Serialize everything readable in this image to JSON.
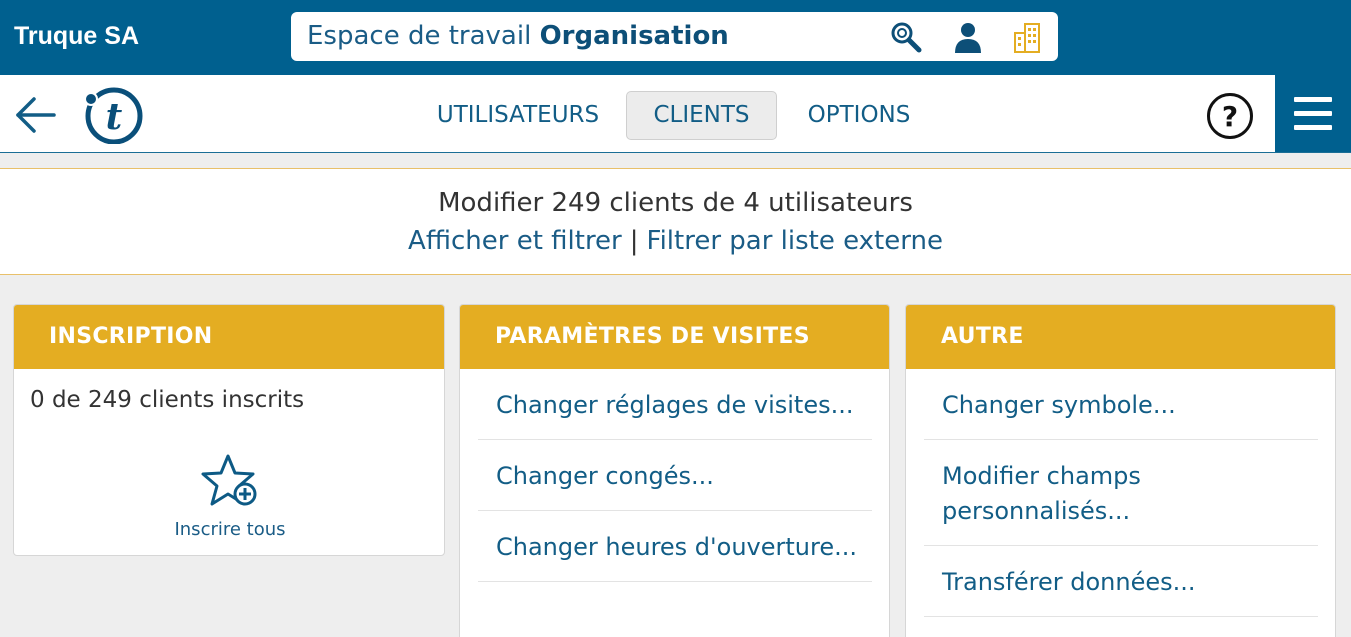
{
  "topbar": {
    "company": "Truque SA",
    "workspace_prefix": "Espace de travail ",
    "workspace_name": "Organisation",
    "icons": [
      "search-icon",
      "user-icon",
      "building-icon"
    ]
  },
  "nav": {
    "tabs": [
      {
        "label": "UTILISATEURS",
        "active": false
      },
      {
        "label": "CLIENTS",
        "active": true
      },
      {
        "label": "OPTIONS",
        "active": false
      }
    ],
    "help": "?"
  },
  "summary": {
    "title": "Modifier 249 clients de 4 utilisateurs",
    "link_show": "Afficher et filtrer",
    "separator": "|",
    "link_external": "Filtrer par liste externe"
  },
  "cards": {
    "inscription": {
      "title": "INSCRIPTION",
      "status": "0 de 249 clients inscrits",
      "enroll_all": "Inscrire tous"
    },
    "visits": {
      "title": "PARAMÈTRES DE VISITES",
      "items": [
        "Changer réglages de visites...",
        "Changer congés...",
        "Changer heures d'ouverture..."
      ]
    },
    "other": {
      "title": "AUTRE",
      "items": [
        "Changer symbole...",
        "Modifier champs personnalisés...",
        "Transférer données..."
      ]
    }
  },
  "colors": {
    "primary": "#00608f",
    "accent": "#e4ad22",
    "link": "#125d86"
  }
}
